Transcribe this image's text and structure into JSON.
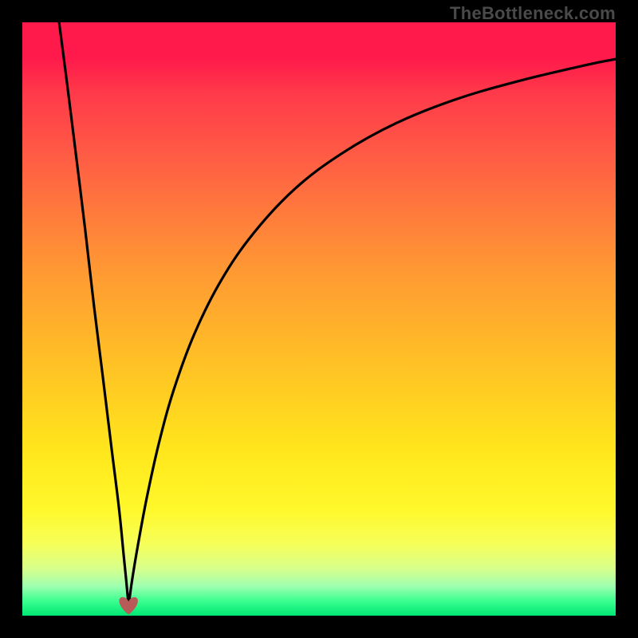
{
  "watermark": "TheBottleneck.com",
  "chart_data": {
    "type": "line",
    "title": "",
    "xlabel": "",
    "ylabel": "",
    "xlim": [
      0,
      100
    ],
    "ylim": [
      0,
      100
    ],
    "grid": false,
    "legend": false,
    "background_gradient": {
      "top": "#ff1a4b",
      "mid": "#ffcc22",
      "bottom": "#00e673"
    },
    "cusp_marker": {
      "shape": "heart",
      "x_pct": 17.9,
      "y_pct": 98.4,
      "color": "#b75a58"
    },
    "series": [
      {
        "name": "left-branch",
        "x_pct": [
          6.2,
          7.5,
          9.0,
          10.6,
          12.1,
          13.6,
          15.0,
          16.3,
          17.1,
          17.6,
          17.9
        ],
        "y_pct": [
          0.0,
          10.0,
          22.0,
          35.0,
          48.0,
          60.0,
          71.5,
          82.0,
          90.0,
          95.0,
          98.4
        ]
      },
      {
        "name": "right-branch",
        "x_pct": [
          17.9,
          18.5,
          19.5,
          21.0,
          23.0,
          25.5,
          29.0,
          33.5,
          39.0,
          46.0,
          54.0,
          63.0,
          73.0,
          84.0,
          95.0,
          100.0
        ],
        "y_pct": [
          98.4,
          94.0,
          88.0,
          80.0,
          71.0,
          62.0,
          52.5,
          43.5,
          35.5,
          28.0,
          22.0,
          17.0,
          13.0,
          9.8,
          7.2,
          6.2
        ]
      }
    ]
  }
}
